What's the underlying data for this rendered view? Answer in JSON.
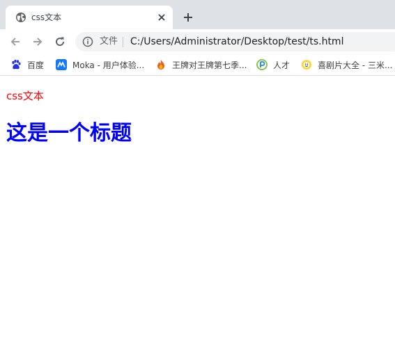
{
  "browser": {
    "tab": {
      "title": "css文本"
    },
    "address_bar": {
      "file_label": "文件",
      "url": "C:/Users/Administrator/Desktop/test/ts.html"
    },
    "bookmarks": [
      {
        "label": "百度",
        "icon": "baidu-paw-icon"
      },
      {
        "label": "Moka - 用户体验...",
        "icon": "moka-icon"
      },
      {
        "label": "王牌对王牌第七季...",
        "icon": "flame-icon"
      },
      {
        "label": "人才",
        "icon": "rencai-icon"
      },
      {
        "label": "喜剧片大全 - 三米...",
        "icon": "smiley-icon"
      }
    ]
  },
  "page": {
    "css_text": "css文本",
    "heading": "这是一个标题"
  },
  "colors": {
    "text_red": "#ff0000",
    "heading_blue": "#0000ff"
  }
}
